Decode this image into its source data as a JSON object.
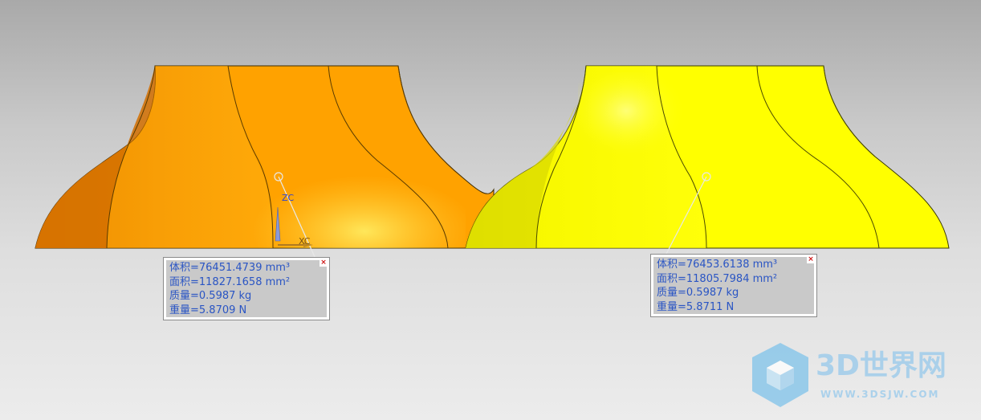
{
  "colors": {
    "left_part": "#ffa500",
    "right_part": "#ffff00",
    "label_text": "#2a55c4",
    "close_button": "#cc1111"
  },
  "axes": {
    "z_label": "ZC",
    "x_label": "XC"
  },
  "measurements": [
    {
      "id": "left",
      "lines": [
        "体积=76451.4739 mm³",
        "面积=11827.1658 mm²",
        "质量=0.5987 kg",
        "重量=5.8709 N"
      ],
      "close_label": "×"
    },
    {
      "id": "right",
      "lines": [
        "体积=76453.6138 mm³",
        "面积=11805.7984 mm²",
        "质量=0.5987 kg",
        "重量=5.8711 N"
      ],
      "close_label": "×"
    }
  ],
  "watermark": {
    "icon": "cube-logo-icon",
    "title": "3D世界网",
    "url": "WWW.3DSJW.COM"
  }
}
